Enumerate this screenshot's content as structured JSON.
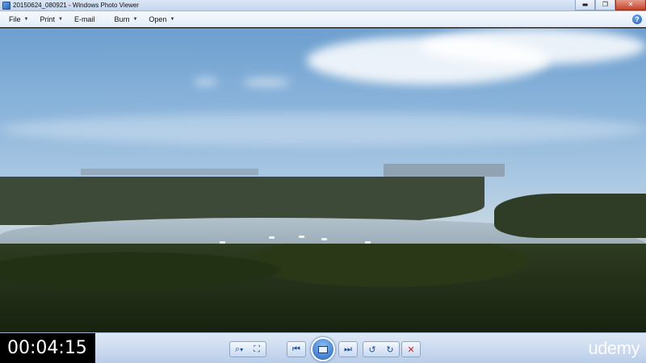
{
  "window": {
    "title": "20150624_080921 - Windows Photo Viewer",
    "minimize_glyph": "▬",
    "maximize_glyph": "❐",
    "close_glyph": "✕"
  },
  "menu": {
    "items": [
      {
        "label": "File",
        "icon": "chevron-down-icon"
      },
      {
        "label": "Print",
        "icon": "chevron-down-icon"
      },
      {
        "label": "E-mail",
        "icon": ""
      },
      {
        "label": "Burn",
        "icon": "chevron-down-icon"
      },
      {
        "label": "Open",
        "icon": "chevron-down-icon"
      }
    ],
    "caret_glyph": "▼",
    "help_glyph": "?"
  },
  "controls": {
    "timer": "00:04:15",
    "zoom_glyph": "⌕",
    "zoom_caret": "▾",
    "actual_size_glyph": "⛶",
    "previous_glyph": "⏮",
    "next_glyph": "⏭",
    "rotate_ccw_glyph": "↺",
    "rotate_cw_glyph": "↻",
    "delete_glyph": "✕",
    "watermark": "udemy"
  }
}
